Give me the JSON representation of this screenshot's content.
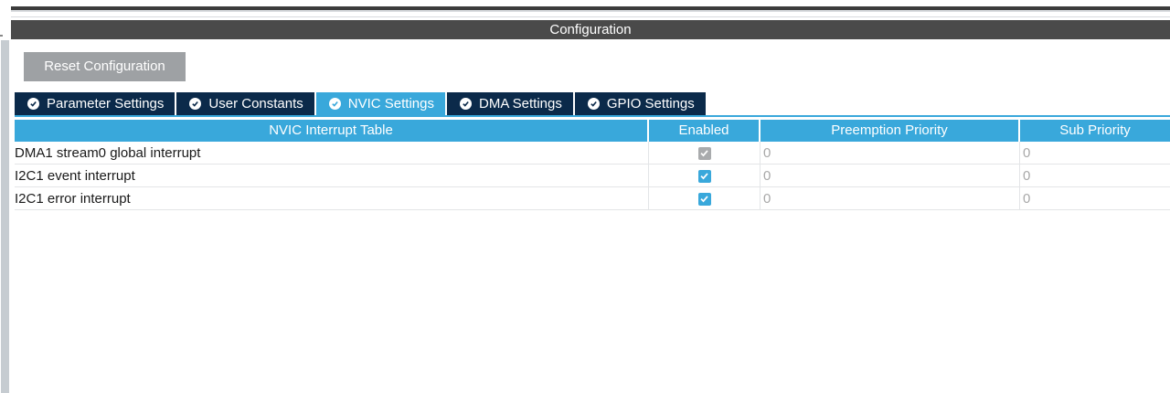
{
  "window": {
    "title": "Configuration"
  },
  "toolbar": {
    "reset_label": "Reset Configuration"
  },
  "tabs": [
    {
      "label": "Parameter Settings",
      "active": false
    },
    {
      "label": "User Constants",
      "active": false
    },
    {
      "label": "NVIC Settings",
      "active": true
    },
    {
      "label": "DMA Settings",
      "active": false
    },
    {
      "label": "GPIO Settings",
      "active": false
    }
  ],
  "table": {
    "headers": [
      "NVIC Interrupt Table",
      "Enabled",
      "Preemption Priority",
      "Sub Priority"
    ],
    "rows": [
      {
        "name": "DMA1 stream0 global interrupt",
        "enabled": true,
        "editable": false,
        "preemption": "0",
        "sub": "0"
      },
      {
        "name": "I2C1 event interrupt",
        "enabled": true,
        "editable": true,
        "preemption": "0",
        "sub": "0"
      },
      {
        "name": "I2C1 error interrupt",
        "enabled": true,
        "editable": true,
        "preemption": "0",
        "sub": "0"
      }
    ]
  },
  "colors": {
    "accent": "#39a8db",
    "tab_dark": "#0b2a4a",
    "header_dark": "#4a4a4a",
    "checkbox_disabled": "#a9abad",
    "checkbox_enabled": "#39a8db"
  },
  "icons": {
    "tab_status": "check-circle-icon",
    "checkbox": "checkmark-icon"
  }
}
